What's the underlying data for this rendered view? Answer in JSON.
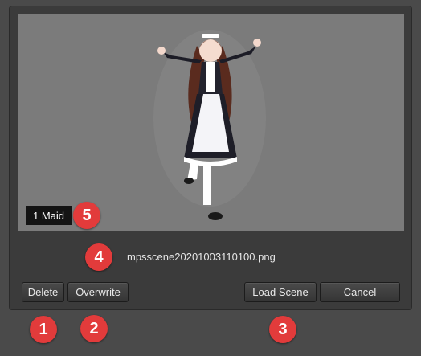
{
  "preview": {
    "character_count_label": "1 Maid",
    "image_description": "maid-character-render"
  },
  "file": {
    "name": "mpsscene20201003110100.png"
  },
  "buttons": {
    "delete": "Delete",
    "overwrite": "Overwrite",
    "load_scene": "Load Scene",
    "cancel": "Cancel"
  },
  "markers": [
    "1",
    "2",
    "3",
    "4",
    "5"
  ],
  "colors": {
    "dialog_bg": "#3b3b3b",
    "preview_bg": "#7b7b7b",
    "marker": "#e23b3b"
  }
}
